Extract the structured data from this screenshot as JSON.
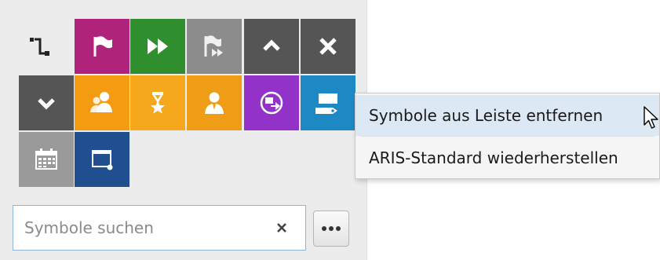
{
  "toolbar": {
    "tiles": [
      {
        "icon": "connector-icon",
        "color": "transparent"
      },
      {
        "icon": "flag-icon",
        "color": "#b0237a"
      },
      {
        "icon": "fast-forward-icon",
        "color": "#2f8f2f"
      },
      {
        "icon": "flag-skip-icon",
        "color": "#8c8c8c"
      },
      {
        "icon": "chevron-up-icon",
        "color": "#555555"
      },
      {
        "icon": "close-icon",
        "color": "#555555"
      },
      {
        "icon": "chevron-down-icon",
        "color": "#555555"
      },
      {
        "icon": "user-group-icon",
        "color": "#f39c12"
      },
      {
        "icon": "award-icon",
        "color": "#f5a81c"
      },
      {
        "icon": "person-icon",
        "color": "#ef9c16"
      },
      {
        "icon": "process-link-icon",
        "color": "#9332c9"
      },
      {
        "icon": "screen-tag-icon",
        "color": "#1c88c4"
      },
      {
        "icon": "calendar-icon",
        "color": "#9a9a9a"
      },
      {
        "icon": "window-icon",
        "color": "#1f4f8e"
      }
    ]
  },
  "search": {
    "placeholder": "Symbole suchen",
    "value": "",
    "clear_icon": "close-icon",
    "more_icon": "more-dots-icon"
  },
  "context_menu": {
    "items": [
      {
        "label": "Symbole aus Leiste entfernen"
      },
      {
        "label": "ARIS-Standard wiederherstellen"
      }
    ],
    "cursor_icon": "mouse-pointer-icon"
  }
}
